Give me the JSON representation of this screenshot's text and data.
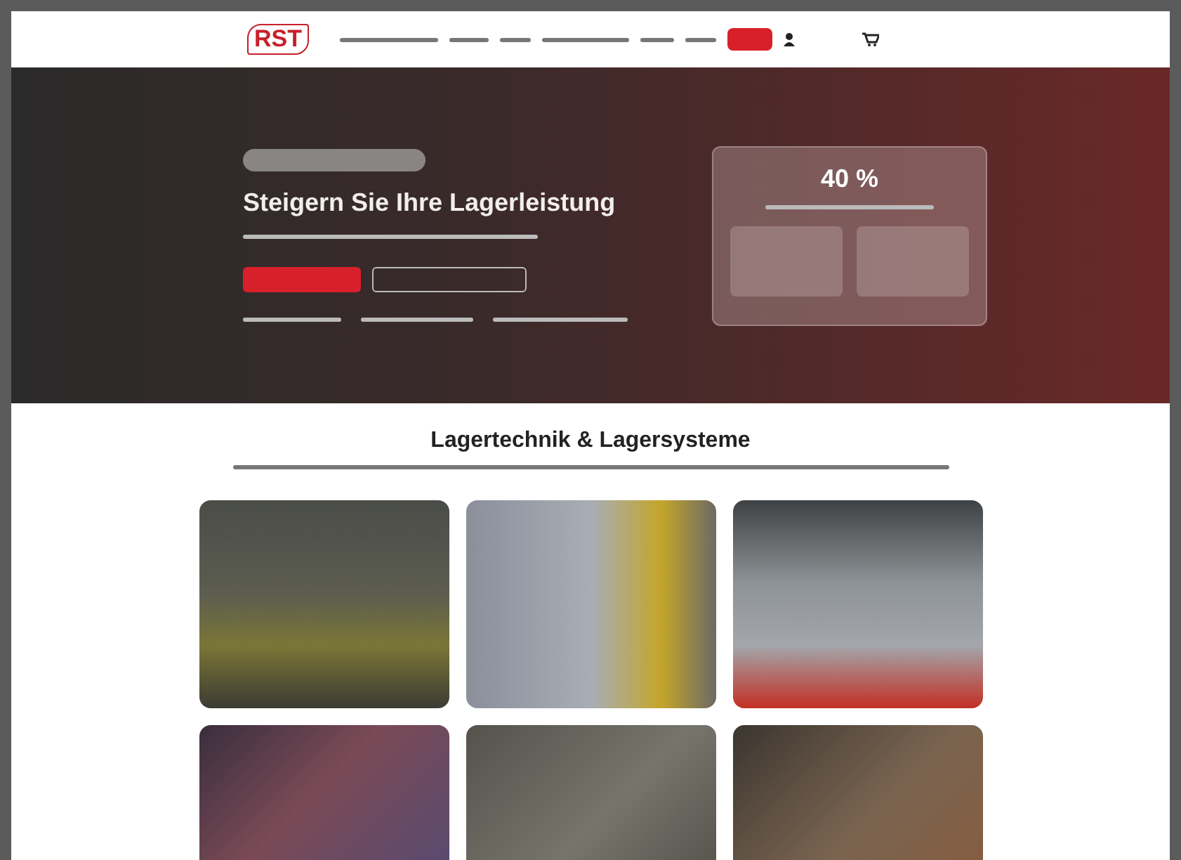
{
  "header": {
    "logo": "RST"
  },
  "hero": {
    "title": "Steigern Sie Ihre Lagerleistung",
    "stat_value": "40 %"
  },
  "section": {
    "title": "Lagertechnik & Lagersysteme"
  }
}
